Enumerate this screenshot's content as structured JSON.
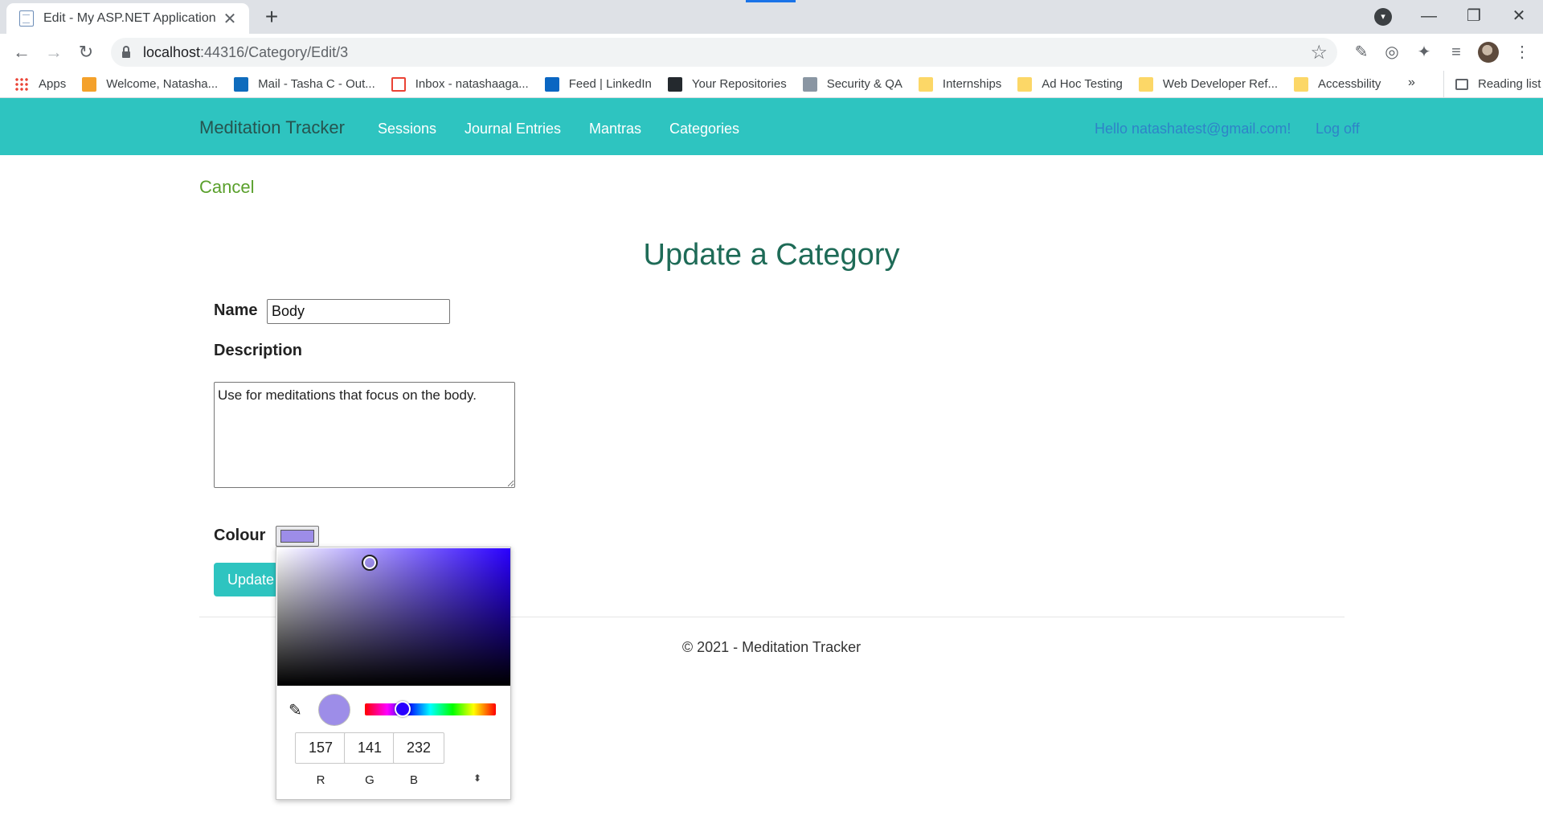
{
  "browser": {
    "tab_title": "Edit - My ASP.NET Application",
    "url_host": "localhost",
    "url_path": ":44316/Category/Edit/3",
    "bookmarks": [
      {
        "label": "Apps",
        "icon": "apps-icon"
      },
      {
        "label": "Welcome, Natasha...",
        "icon": "welcome-icon"
      },
      {
        "label": "Mail - Tasha C - Out...",
        "icon": "outlook-icon"
      },
      {
        "label": "Inbox - natashaaga...",
        "icon": "gmail-icon"
      },
      {
        "label": "Feed | LinkedIn",
        "icon": "linkedin-icon"
      },
      {
        "label": "Your Repositories",
        "icon": "github-icon"
      },
      {
        "label": "Security & QA",
        "icon": "security-icon"
      },
      {
        "label": "Internships",
        "icon": "folder-icon"
      },
      {
        "label": "Ad Hoc Testing",
        "icon": "folder-icon"
      },
      {
        "label": "Web Developer Ref...",
        "icon": "folder-icon"
      },
      {
        "label": "Accessbility",
        "icon": "folder-icon"
      }
    ],
    "bookmarks_overflow": "»",
    "reading_list": "Reading list"
  },
  "navbar": {
    "brand": "Meditation Tracker",
    "links": [
      "Sessions",
      "Journal Entries",
      "Mantras",
      "Categories"
    ],
    "user_greeting": "Hello natashatest@gmail.com!",
    "logoff": "Log off"
  },
  "page": {
    "cancel": "Cancel",
    "title": "Update a Category",
    "name_label": "Name",
    "name_value": "Body",
    "description_label": "Description",
    "description_value": "Use for meditations that focus on the body.",
    "colour_label": "Colour",
    "update_button": "Update",
    "footer": "© 2021 - Meditation Tracker"
  },
  "color_picker": {
    "selected_color": "#9d8de8",
    "hue_color": "#2a00ff",
    "r": "157",
    "g": "141",
    "b": "232",
    "r_label": "R",
    "g_label": "G",
    "b_label": "B"
  },
  "colors": {
    "navbar_bg": "#2ec4c0",
    "brand_text": "#26544f",
    "title_text": "#1e6b57",
    "cancel_link": "#5aa02c",
    "user_link": "#2f83c8"
  }
}
